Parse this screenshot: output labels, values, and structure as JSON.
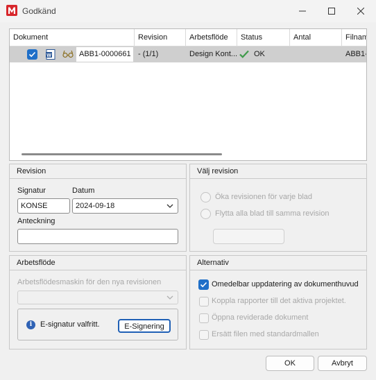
{
  "window": {
    "title": "Godkänd",
    "app_icon_letter": "M"
  },
  "grid": {
    "columns": [
      "Dokument",
      "Revision",
      "Arbetsflöde",
      "Status",
      "Antal",
      "Filnamn"
    ],
    "row": {
      "checked": true,
      "document": "ABB1-0000661",
      "revision": "- (1/1)",
      "workflow": "Design Kont...",
      "status": "OK",
      "count": "",
      "filename": "ABB1-0"
    }
  },
  "revision": {
    "title": "Revision",
    "signature_label": "Signatur",
    "signature_value": "KONSE",
    "date_label": "Datum",
    "date_value": "2024-09-18",
    "note_label": "Anteckning",
    "note_value": ""
  },
  "select_revision": {
    "title": "Välj revision",
    "option1": "Öka revisionen för varje blad",
    "option2": "Flytta alla blad till samma revision"
  },
  "workflow": {
    "title": "Arbetsflöde",
    "engine_label": "Arbetsflödesmaskin för den nya revisionen",
    "engine_value": "",
    "esign_info": "E-signatur valfritt.",
    "esign_button": "E-Signering"
  },
  "options": {
    "title": "Alternativ",
    "items": [
      {
        "label": "Omedelbar uppdatering av dokumenthuvud",
        "checked": true,
        "enabled": true
      },
      {
        "label": "Koppla rapporter till det aktiva projektet.",
        "checked": false,
        "enabled": false
      },
      {
        "label": "Öppna reviderade dokument",
        "checked": false,
        "enabled": false
      },
      {
        "label": "Ersätt filen med standardmallen",
        "checked": false,
        "enabled": false
      }
    ]
  },
  "footer": {
    "ok": "OK",
    "cancel": "Avbryt"
  },
  "colors": {
    "accent": "#1f6fc8",
    "status_ok": "#3f9a4a",
    "app_red": "#d7262b"
  }
}
